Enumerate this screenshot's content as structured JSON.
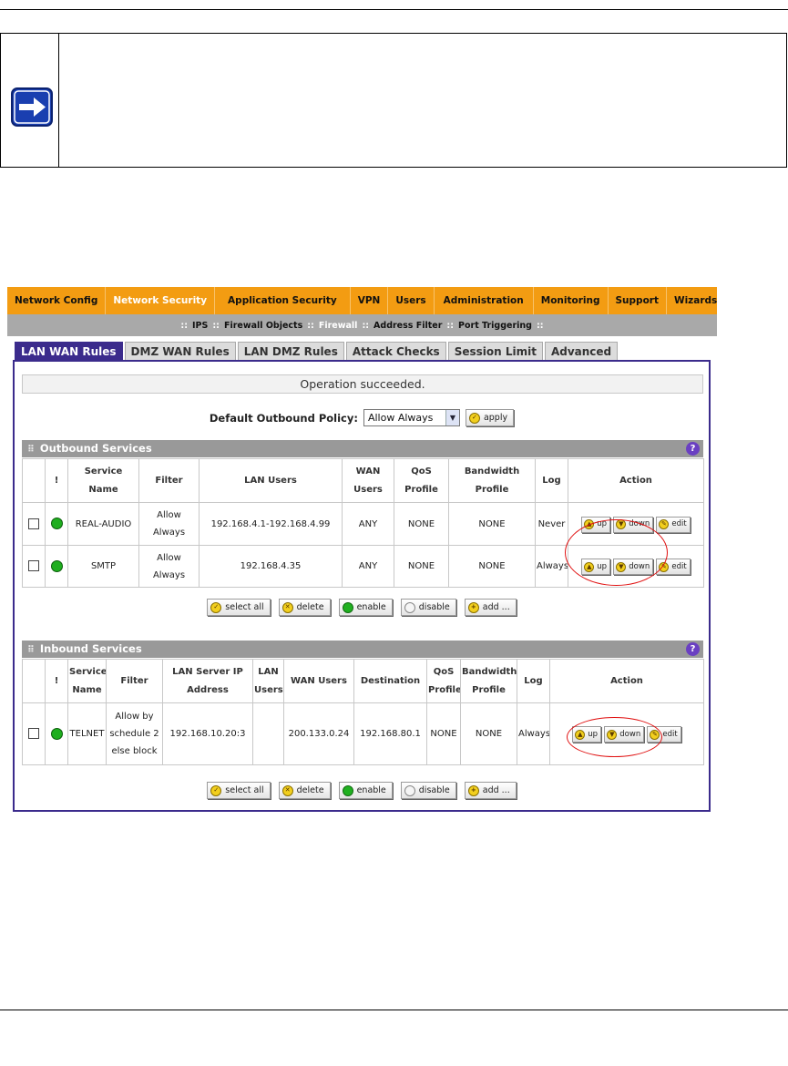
{
  "nav": {
    "primary": [
      "Network Config",
      "Network Security",
      "Application Security",
      "VPN",
      "Users",
      "Administration",
      "Monitoring",
      "Support",
      "Wizards"
    ],
    "primary_active": "Network Security",
    "secondary": [
      "IPS",
      "Firewall Objects",
      "Firewall",
      "Address Filter",
      "Port Triggering"
    ],
    "secondary_active": "Firewall"
  },
  "tabs": [
    "LAN WAN Rules",
    "DMZ WAN Rules",
    "LAN DMZ Rules",
    "Attack Checks",
    "Session Limit",
    "Advanced"
  ],
  "tabs_active": "LAN WAN Rules",
  "status": {
    "message": "Operation succeeded."
  },
  "policy": {
    "label": "Default Outbound Policy:",
    "value": "Allow Always",
    "apply_label": "apply"
  },
  "outbound": {
    "title": "Outbound Services",
    "headers": {
      "status": "!",
      "service": "Service Name",
      "filter": "Filter",
      "lan_users": "LAN Users",
      "wan_users": "WAN Users",
      "qos": "QoS Profile",
      "bandwidth": "Bandwidth Profile",
      "log": "Log",
      "action": "Action"
    },
    "rows": [
      {
        "service": "REAL-AUDIO",
        "filter": "Allow Always",
        "lan_users": "192.168.4.1-192.168.4.99",
        "wan_users": "ANY",
        "qos": "NONE",
        "bandwidth": "NONE",
        "log": "Never"
      },
      {
        "service": "SMTP",
        "filter": "Allow Always",
        "lan_users": "192.168.4.35",
        "wan_users": "ANY",
        "qos": "NONE",
        "bandwidth": "NONE",
        "log": "Always"
      }
    ]
  },
  "inbound": {
    "title": "Inbound Services",
    "headers": {
      "status": "!",
      "service": "Service Name",
      "filter": "Filter",
      "lan_server": "LAN Server IP Address",
      "lan_users": "LAN Users",
      "wan_users": "WAN Users",
      "destination": "Destination",
      "qos": "QoS Profile",
      "bandwidth": "Bandwidth Profile",
      "log": "Log",
      "action": "Action"
    },
    "rows": [
      {
        "service": "TELNET",
        "filter": "Allow by schedule 2 else block",
        "lan_server": "192.168.10.20:3",
        "lan_users": "",
        "wan_users": "200.133.0.24",
        "destination": "192.168.80.1",
        "qos": "NONE",
        "bandwidth": "NONE",
        "log": "Always"
      }
    ]
  },
  "row_actions": {
    "up": "up",
    "down": "down",
    "edit": "edit"
  },
  "bulk_actions": {
    "select_all": "select all",
    "delete": "delete",
    "enable": "enable",
    "disable": "disable",
    "add": "add ..."
  },
  "colors": {
    "nav_primary": "#f39c12",
    "nav_secondary": "#a9a9a9",
    "tab_active": "#3b2b8c",
    "section_bar": "#999999",
    "status_enabled": "#1fae1f",
    "highlight_ring": "#e01010"
  }
}
